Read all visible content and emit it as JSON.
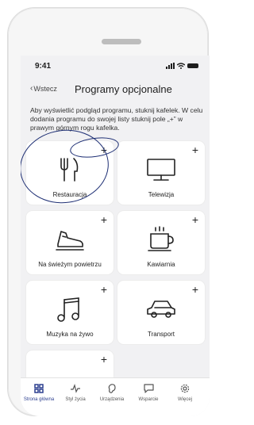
{
  "status": {
    "time": "9:41"
  },
  "header": {
    "back_label": "Wstecz",
    "title": "Programy opcjonalne"
  },
  "description": "Aby wyświetlić podgląd programu, stuknij kafelek. W celu dodania programu do swojej listy stuknij pole „+” w prawym górnym rogu kafelka.",
  "tiles": [
    {
      "label": "Restauracja",
      "icon": "fork-knife-icon"
    },
    {
      "label": "Telewizja",
      "icon": "tv-icon"
    },
    {
      "label": "Na świeżym powietrzu",
      "icon": "shoe-icon"
    },
    {
      "label": "Kawiarnia",
      "icon": "coffee-cup-icon"
    },
    {
      "label": "Muzyka na żywo",
      "icon": "music-note-icon"
    },
    {
      "label": "Transport",
      "icon": "car-icon"
    },
    {
      "label": "",
      "icon": ""
    }
  ],
  "plus_glyph": "+",
  "tabbar": [
    {
      "label": "Strona główna",
      "icon": "home-grid-icon",
      "active": true
    },
    {
      "label": "Styl życia",
      "icon": "activity-icon",
      "active": false
    },
    {
      "label": "Urządzenia",
      "icon": "hearing-aid-icon",
      "active": false
    },
    {
      "label": "Wsparcie",
      "icon": "chat-icon",
      "active": false
    },
    {
      "label": "Więcej",
      "icon": "settings-icon",
      "active": false
    }
  ],
  "colors": {
    "accent": "#2b3e8f",
    "annotation": "#1e2f74",
    "background": "#f1f1f3"
  }
}
